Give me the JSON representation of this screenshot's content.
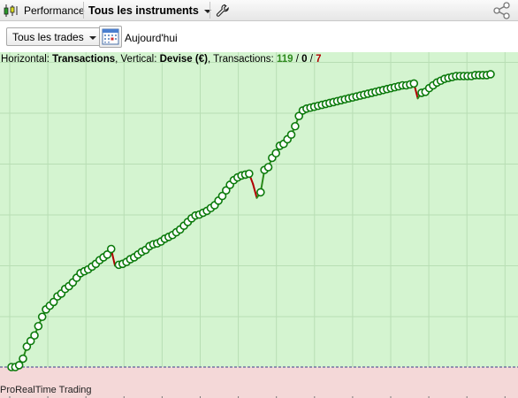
{
  "toolbar": {
    "performance_label": "Performance",
    "instruments_label": "Tous les instruments",
    "icons": [
      "candlestick-icon",
      "wrench-icon",
      "share-icon"
    ]
  },
  "controls": {
    "trades_filter": "Tous les trades",
    "date_label": "Aujourd'hui"
  },
  "info": {
    "horizontal_prefix": "Horizontal: ",
    "horizontal_value": "Transactions",
    "vertical_prefix": ", Vertical: ",
    "vertical_value": "Devise (€)",
    "transactions_prefix": ", Transactions: ",
    "winning": "119",
    "sep1": " / ",
    "neutral": "0",
    "sep2": " / ",
    "losing": "7"
  },
  "footer": "ProRealTime Trading",
  "colors": {
    "positive_area": "#d4f4d0",
    "negative_area": "#f4d8d8",
    "win_line": "#2a8a1a",
    "loss_line": "#b00000",
    "marker_fill": "#ffffff",
    "marker_stroke": "#0b7a0b",
    "grid": "#b8deb4",
    "zero_line": "#3a3a8a",
    "winning_text": "#2f8a1f",
    "losing_text": "#b00000"
  },
  "chart_data": {
    "type": "line",
    "xlabel": "Transactions",
    "ylabel": "Devise (€)",
    "ylim": [
      -11,
      313
    ],
    "grid": true,
    "series": [
      {
        "values": [
          0,
          0,
          2,
          9,
          22,
          28,
          34,
          44,
          54,
          62,
          66,
          70,
          76,
          79,
          84,
          87,
          91,
          96,
          101,
          103,
          105,
          108,
          111,
          115,
          118,
          121,
          127,
          109,
          110,
          111,
          113,
          116,
          118,
          121,
          124,
          126,
          130,
          132,
          133,
          135,
          138,
          140,
          142,
          145,
          148,
          152,
          156,
          160,
          163,
          164,
          166,
          168,
          171,
          174,
          179,
          184,
          190,
          196,
          201,
          204,
          206,
          207,
          208,
          197,
          182,
          188,
          212,
          215,
          225,
          230,
          238,
          240,
          245,
          250,
          259,
          270,
          276,
          278,
          279,
          280,
          281,
          282,
          283,
          284,
          285,
          286,
          287,
          288,
          289,
          290,
          291,
          292,
          293,
          294,
          295,
          296,
          297,
          298,
          299,
          300,
          301,
          302,
          303,
          303,
          304,
          305,
          289,
          295,
          296,
          300,
          303,
          306,
          308,
          310,
          311,
          312,
          313,
          313,
          313,
          313,
          313,
          314,
          314,
          314,
          314,
          315
        ]
      }
    ]
  }
}
